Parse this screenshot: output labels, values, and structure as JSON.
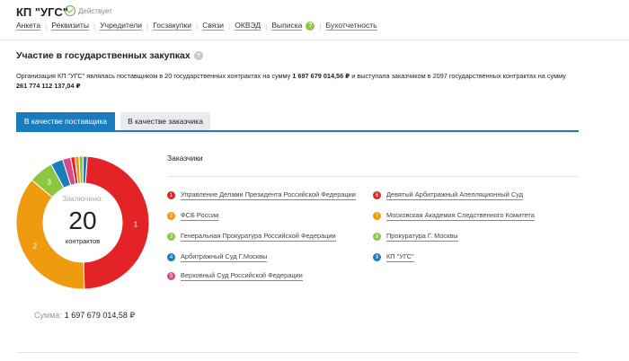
{
  "header": {
    "company": "КП \"УГС\"",
    "status": "Действует",
    "status_color": "#6ab04c"
  },
  "nav": {
    "items": [
      "Анкета",
      "Реквизиты",
      "Учредители",
      "Госзакупки",
      "Связи",
      "ОКВЭД",
      "Выписка",
      "Бухотчетность"
    ],
    "help_badge": "?"
  },
  "section": {
    "title": "Участие в государственных закупках",
    "help_badge": "?"
  },
  "description": {
    "part1": "Организация КП \"УГС\" являлась поставщиком в 20 государственных контрактах на сумму ",
    "amount1": "1 697 679 014,56 ₽",
    "part2": " и выступала заказчиком в 2097 государственных контрактах на сумму",
    "amount2": "261 774 112 137,04 ₽"
  },
  "tabs": [
    {
      "label": "В качестве поставщика",
      "active": true
    },
    {
      "label": "В качестве заказчика",
      "active": false
    }
  ],
  "accent_color": "#1a7bbf",
  "donut": {
    "label_top": "Заключено:",
    "number": "20",
    "label_bottom": "контрактов"
  },
  "chart_data": {
    "type": "pie",
    "values": [
      48.5,
      36.5,
      6.0,
      3.0,
      2.0,
      1.0,
      1.0,
      1.0,
      1.0
    ],
    "colors": [
      "#e32326",
      "#ef9b0f",
      "#8dc63f",
      "#1a7bbf",
      "#d9488b",
      "#e32326",
      "#ef9b0f",
      "#8dc63f",
      "#1a7bbf"
    ],
    "slice_labels": [
      "1",
      "2",
      "3",
      "",
      "",
      "",
      "",
      "",
      ""
    ],
    "start_angle": 4
  },
  "sum": {
    "label": "Сумма:",
    "value": "1 697 679 014,58 ₽"
  },
  "customers": {
    "title": "Заказчики",
    "items": [
      {
        "num": "1",
        "name": "Управление Делами Президента Российской Федерации",
        "color": "#e32326"
      },
      {
        "num": "2",
        "name": "ФСБ России",
        "color": "#ef9b0f"
      },
      {
        "num": "3",
        "name": "Генеральная Прокуратура Российской Федерации",
        "color": "#8dc63f"
      },
      {
        "num": "4",
        "name": "Арбитражный Суд Г.Москвы",
        "color": "#1a7bbf"
      },
      {
        "num": "5",
        "name": "Верховный Суд Российской Федерации",
        "color": "#d9488b"
      },
      {
        "num": "6",
        "name": "Девятый Арбитражный Апелляционный Суд",
        "color": "#e32326"
      },
      {
        "num": "7",
        "name": "Московская Академия Следственного Комитета",
        "color": "#ef9b0f"
      },
      {
        "num": "8",
        "name": "Прокуратура Г. Москвы",
        "color": "#8dc63f"
      },
      {
        "num": "9",
        "name": "КП \"УГС\"",
        "color": "#1a7bbf"
      }
    ]
  }
}
